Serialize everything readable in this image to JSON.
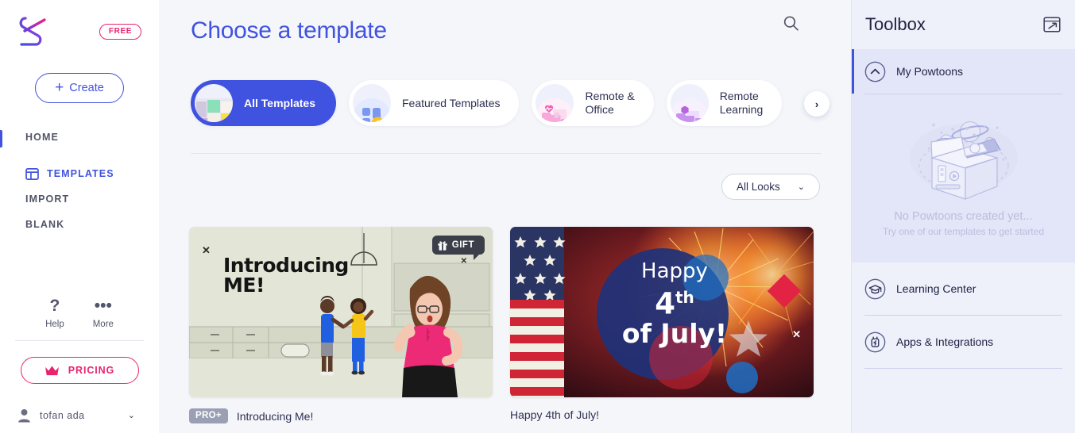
{
  "sidebar": {
    "logo_name": "powtoon-logo",
    "plan_badge": "FREE",
    "create_label": "Create",
    "create_plus": "+",
    "nav": [
      {
        "label": "HOME",
        "name": "sidebar-item-home",
        "active": false
      },
      {
        "label": "TEMPLATES",
        "name": "sidebar-item-templates",
        "active": true
      },
      {
        "label": "IMPORT",
        "name": "sidebar-item-import",
        "active": false
      },
      {
        "label": "BLANK",
        "name": "sidebar-item-blank",
        "active": false
      }
    ],
    "help": {
      "glyph": "?",
      "label": "Help"
    },
    "more": {
      "glyph": "•••",
      "label": "More"
    },
    "pricing_label": "PRICING",
    "user_name": "tofan ada",
    "user_caret": "⌄",
    "accent_blue": "#4052e0",
    "accent_pink": "#e8246e"
  },
  "main": {
    "page_title": "Choose a template",
    "search_icon": "search-icon",
    "next_arrow": "›",
    "tabs": [
      {
        "label": "All Templates",
        "active": true,
        "thumb": "all-templates-thumb"
      },
      {
        "label": "Featured Templates",
        "active": false,
        "thumb": "featured-templates-thumb"
      },
      {
        "label": "Remote &\nOffice",
        "active": false,
        "thumb": "remote-office-thumb"
      },
      {
        "label": "Remote\nLearning",
        "active": false,
        "thumb": "remote-learning-thumb"
      }
    ],
    "filter": {
      "label": "All Looks",
      "caret": "⌄"
    },
    "cards": [
      {
        "title": "Introducing Me!",
        "badge": "PRO+",
        "has_badge": true,
        "overlay_title_line1": "Introducing",
        "overlay_title_line2": "ME!",
        "gift_label": "GIFT",
        "close_x": "✕",
        "gift_close_x": "✕"
      },
      {
        "title": "Happy 4th of July!",
        "badge": "",
        "has_badge": false,
        "overlay_line1": "Happy",
        "overlay_line2": "4",
        "overlay_line2_sup": "th",
        "overlay_line3": "of July!",
        "close_x": "✕"
      }
    ]
  },
  "toolbox": {
    "title": "Toolbox",
    "expand_icon": "open-in-new-window-icon",
    "sections": [
      {
        "label": "My Powtoons",
        "icon": "chevron-up-circle-icon",
        "active": true
      },
      {
        "label": "Learning Center",
        "icon": "graduation-cap-circle-icon",
        "active": false
      },
      {
        "label": "Apps & Integrations",
        "icon": "plug-circle-icon",
        "active": false
      }
    ],
    "empty_state": {
      "illustration": "open-box-space-illustration",
      "title": "No Powtoons created yet...",
      "subtitle": "Try one of our templates to get started"
    }
  }
}
